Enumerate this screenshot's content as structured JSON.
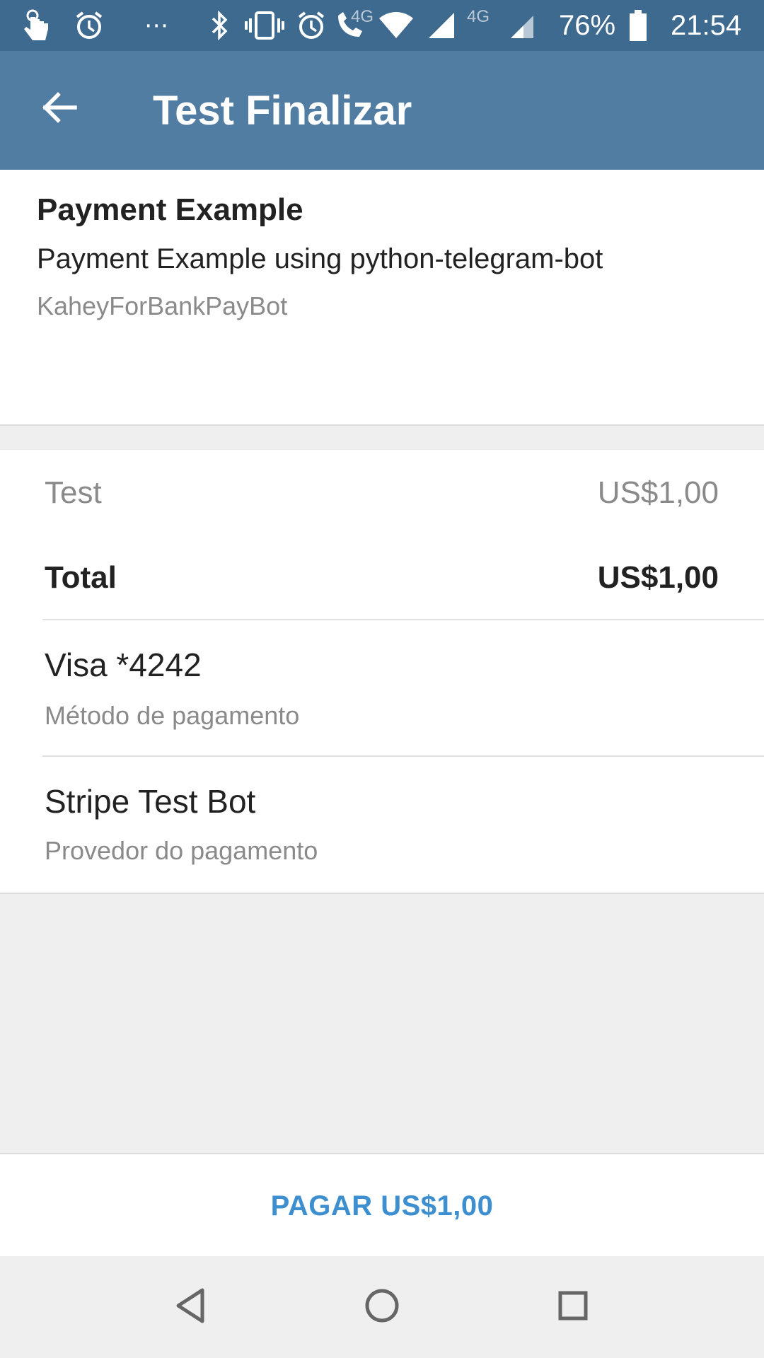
{
  "status_bar": {
    "battery": "76%",
    "time": "21:54",
    "network_small_1": "4G",
    "network_small_2": "4G",
    "icons": [
      "touch-icon",
      "alarm-icon",
      "more-dots-icon",
      "bluetooth-icon",
      "vibrate-icon",
      "alarm-icon",
      "wifi-call-icon",
      "wifi-icon",
      "signal-icon",
      "signal-icon",
      "battery-icon"
    ]
  },
  "toolbar": {
    "back_icon": "arrow-left-icon",
    "title": "Test Finalizar"
  },
  "invoice": {
    "title": "Payment Example",
    "description": "Payment Example using python-telegram-bot",
    "bot": "KaheyForBankPayBot"
  },
  "prices": {
    "item_label": "Test",
    "item_value": "US$1,00",
    "total_label": "Total",
    "total_value": "US$1,00"
  },
  "payment_method": {
    "title": "Visa *4242",
    "subtitle": "Método de pagamento"
  },
  "provider": {
    "title": "Stripe Test Bot",
    "subtitle": "Provedor do pagamento"
  },
  "pay_button": {
    "label": "PAGAR US$1,00"
  },
  "nav": {
    "icons": [
      "back-triangle-icon",
      "home-circle-icon",
      "recents-square-icon"
    ]
  },
  "colors": {
    "status_bar": "#3f6a8f",
    "toolbar": "#517da2",
    "accent": "#3d8fcf"
  }
}
